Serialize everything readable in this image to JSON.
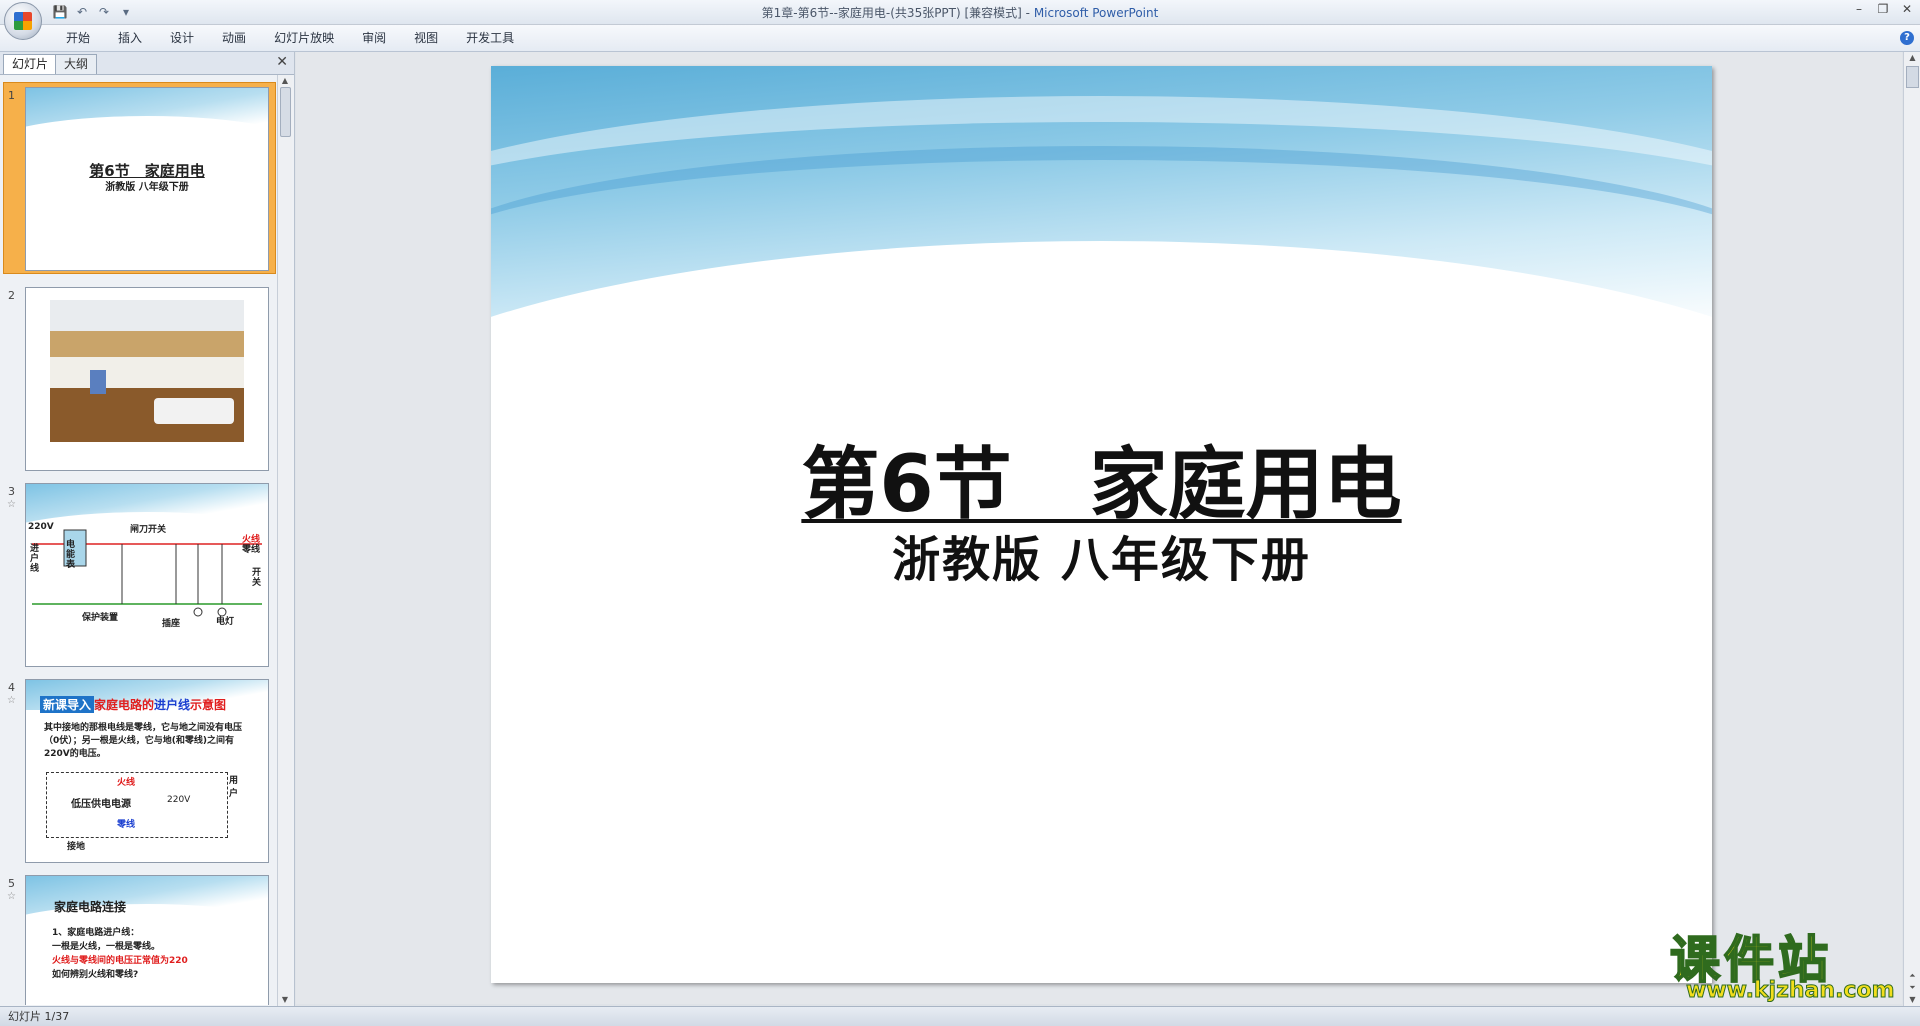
{
  "window": {
    "title_doc": "第1章-第6节--家庭用电-(共35张PPT) [兼容模式] - ",
    "title_app": "Microsoft PowerPoint"
  },
  "qat": {
    "save_icon": "save-icon",
    "undo_icon": "undo-icon",
    "redo_icon": "redo-icon",
    "customize_icon": "customize-qat-icon"
  },
  "ribbon": {
    "tabs": [
      "开始",
      "插入",
      "设计",
      "动画",
      "幻灯片放映",
      "审阅",
      "视图",
      "开发工具"
    ]
  },
  "pane": {
    "tab_slides": "幻灯片",
    "tab_outline": "大纲",
    "close": "✕"
  },
  "thumbnails": [
    {
      "num": "1",
      "title": "第6节　家庭用电",
      "subtitle": "浙教版 八年级下册"
    },
    {
      "num": "2"
    },
    {
      "num": "3",
      "star": "☆",
      "labels": [
        "220V",
        "闸刀开关",
        "火线",
        "零线",
        "进户线",
        "电能表",
        "保护装置",
        "插座",
        "电灯",
        "开关"
      ]
    },
    {
      "num": "4",
      "star": "☆",
      "head_box": "新课导入",
      "head_a": "家庭电路的",
      "head_b": "进户线",
      "head_c": "示意图",
      "body": "其中接地的那根电线是零线，它与地之间没有电压（0伏）；另一根是火线，它与地(和零线)之间有220V的电压。",
      "diag_labels": [
        "火线",
        "低压供电电源",
        "220V",
        "零线",
        "用户",
        "接地"
      ]
    },
    {
      "num": "5",
      "star": "☆",
      "title": "家庭电路连接",
      "lines": [
        "1、家庭电路进户线：",
        "一根是火线，一根是零线。",
        "火线与零线间的电压正常值为220",
        "如何辨别火线和零线?"
      ]
    }
  ],
  "slide": {
    "title": "第6节　家庭用电",
    "subtitle": "浙教版  八年级下册"
  },
  "status": {
    "text": "幻灯片 1/37"
  },
  "watermark": {
    "big": "课件站",
    "url": "www.kjzhan.com"
  }
}
